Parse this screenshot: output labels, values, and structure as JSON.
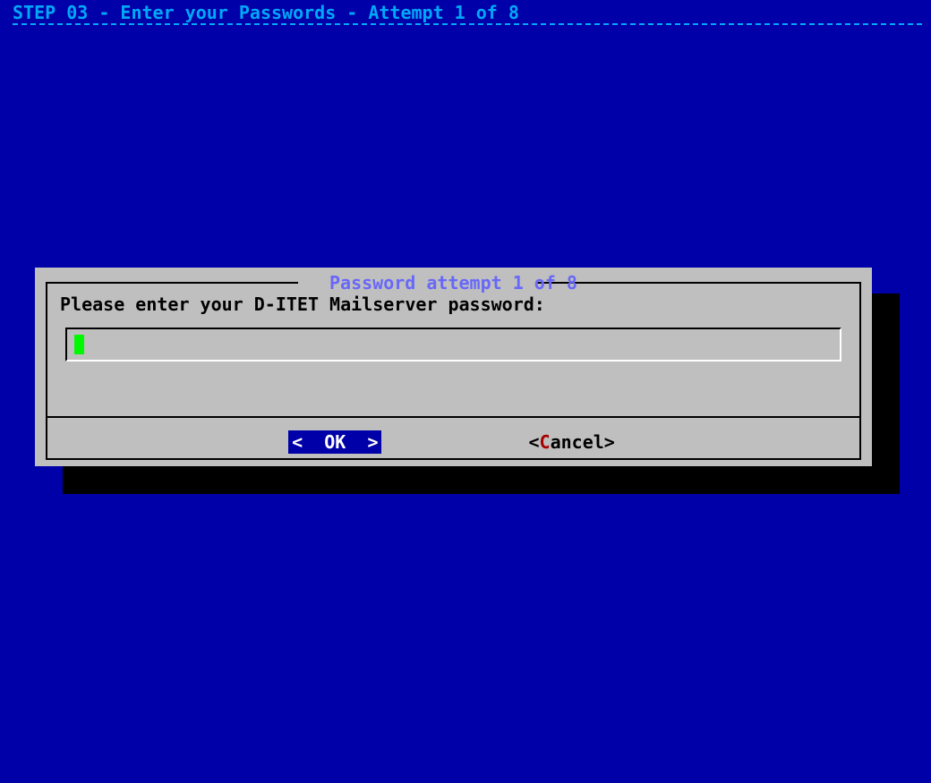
{
  "header": {
    "title": "STEP 03 - Enter your Passwords - Attempt 1 of 8"
  },
  "dialog": {
    "title": "Password attempt 1 of 8",
    "prompt": "Please enter your D-ITET Mailserver password:",
    "input_value": ""
  },
  "buttons": {
    "ok_open": "<  ",
    "ok_label": "OK",
    "ok_close": "  >",
    "cancel_open": "<",
    "cancel_hotkey": "C",
    "cancel_rest": "ancel",
    "cancel_close": ">"
  }
}
